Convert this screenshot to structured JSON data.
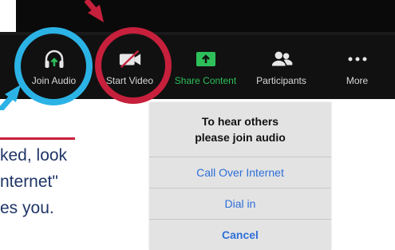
{
  "toolbar": {
    "items": [
      {
        "label": "Join Audio",
        "icon": "headphones-icon"
      },
      {
        "label": "Start Video",
        "icon": "video-off-icon"
      },
      {
        "label": "Share Content",
        "icon": "share-screen-icon"
      },
      {
        "label": "Participants",
        "icon": "participants-icon"
      },
      {
        "label": "More",
        "icon": "more-icon"
      }
    ],
    "share_color": "#2ebf5a"
  },
  "annotations": {
    "ring_blue": "#2bb3e6",
    "ring_red": "#c7203c"
  },
  "tip": {
    "lines": [
      "ked, look",
      "nternet\"",
      "es you."
    ]
  },
  "dialog": {
    "message_line1": "To hear others",
    "message_line2": "please join audio",
    "buttons": [
      "Call Over Internet",
      "Dial in",
      "Cancel"
    ]
  }
}
